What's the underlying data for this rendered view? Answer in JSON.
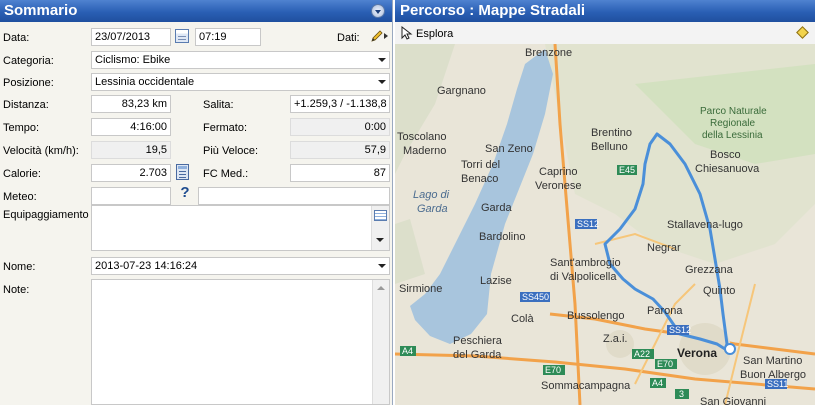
{
  "summary": {
    "title": "Sommario",
    "date_label": "Data:",
    "date_value": "23/07/2013",
    "time_value": "07:19",
    "data_label": "Dati:",
    "category_label": "Categoria:",
    "category_value": "Ciclismo: Ebike",
    "position_label": "Posizione:",
    "position_value": "Lessinia occidentale",
    "distance_label": "Distanza:",
    "distance_value": "83,23 km",
    "climb_label": "Salita:",
    "climb_value": "+1.259,3 / -1.138,8",
    "time_label": "Tempo:",
    "time_total": "4:16:00",
    "stopped_label": "Fermato:",
    "stopped_value": "0:00",
    "speed_label": "Velocità (km/h):",
    "speed_value": "19,5",
    "max_speed_label": "Più Veloce:",
    "max_speed_value": "57,9",
    "calories_label": "Calorie:",
    "calories_value": "2.703",
    "hr_label": "FC Med.:",
    "hr_value": "87",
    "weather_label": "Meteo:",
    "weather_value": "",
    "weather_extra": "",
    "equipment_label": "Equipaggiamento",
    "equipment_value": "",
    "name_label": "Nome:",
    "name_value": "2013-07-23 14:16:24",
    "notes_label": "Note:",
    "notes_value": ""
  },
  "route": {
    "title": "Percorso  : Mappe Stradali",
    "explore_label": "Esplora"
  },
  "map": {
    "labels": {
      "brenzone": "Brenzone",
      "gargnano": "Gargnano",
      "parco1": "Parco Naturale",
      "parco2": "Regionale",
      "parco3": "della Lessinia",
      "toscolano1": "Toscolano",
      "toscolano2": "Maderno",
      "san_zeno": "San Zeno",
      "brentino1": "Brentino",
      "brentino2": "Belluno",
      "bosco1": "Bosco",
      "bosco2": "Chiesanuova",
      "torri1": "Torri del",
      "torri2": "Benaco",
      "caprino1": "Caprino",
      "caprino2": "Veronese",
      "lago1": "Lago di",
      "lago2": "Garda",
      "garda": "Garda",
      "stallavena": "Stallavena-lugo",
      "bardolino": "Bardolino",
      "negrar": "Negrar",
      "grezzana": "Grezzana",
      "santambrogio1": "Sant'ambrogio",
      "santambrogio2": "di Valpolicella",
      "lazise": "Lazise",
      "sirmione": "Sirmione",
      "quinto": "Quinto",
      "cola": "Colà",
      "bussolengo": "Bussolengo",
      "parona": "Parona",
      "peschiera1": "Peschiera",
      "peschiera2": "del Garda",
      "zai": "Z.a.i.",
      "verona": "Verona",
      "sanmartino1": "San Martino",
      "sanmartino2": "Buon Albergo",
      "sommacampagna": "Sommacampagna",
      "sangiovanni": "San Giovanni",
      "shield_e45": "E45",
      "shield_ss12a": "SS12",
      "shield_ss450": "SS450",
      "shield_ss12b": "SS12",
      "shield_a4a": "A4",
      "shield_a4b": "A4",
      "shield_e70a": "E70",
      "shield_e70b": "E70",
      "shield_a22": "A22",
      "shield_ss11": "SS11",
      "shield_3": "3"
    }
  },
  "colors": {
    "title_bar": "#2a5fb4",
    "panel_bg": "#f5f4ee",
    "lake": "#a8c5dd",
    "route": "#4a8fd9",
    "highway": "#f2a24a"
  }
}
